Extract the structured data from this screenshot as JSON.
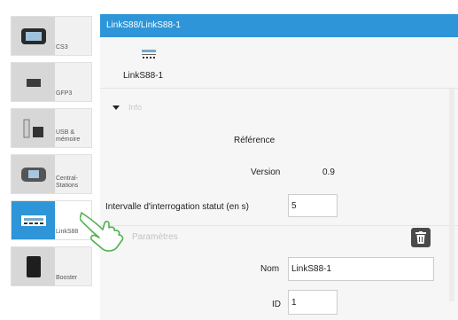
{
  "sidebar": {
    "items": [
      {
        "label": "CS3",
        "icon": "cs3-device-icon"
      },
      {
        "label": "GFP3",
        "icon": "gfp3-card-icon"
      },
      {
        "label": "USB & mémoire",
        "icon": "usb-memory-icon"
      },
      {
        "label": "Central-Stations",
        "icon": "central-station-icon"
      },
      {
        "label": "LinkS88",
        "icon": "links88-module-icon"
      },
      {
        "label": "Booster",
        "icon": "booster-icon"
      }
    ],
    "active": "LinkS88"
  },
  "header": {
    "title": "LinkS88/LinkS88-1"
  },
  "module": {
    "name": "LinkS88-1",
    "icon": "links88-module-icon"
  },
  "info": {
    "section_label": "Info",
    "reference_label": "Référence",
    "reference_value": "",
    "version_label": "Version",
    "version_value": "0.9",
    "poll_label": "Intervalle d'interrogation statut (en s)",
    "poll_value": "5"
  },
  "params": {
    "section_label": "Paramètres",
    "name_label": "Nom",
    "name_value": "LinkS88-1",
    "id_label": "ID",
    "id_value": "1"
  },
  "colors": {
    "accent": "#2e95d8",
    "header_text": "#ffffff",
    "dimmed_text": "#c3c3c3"
  }
}
